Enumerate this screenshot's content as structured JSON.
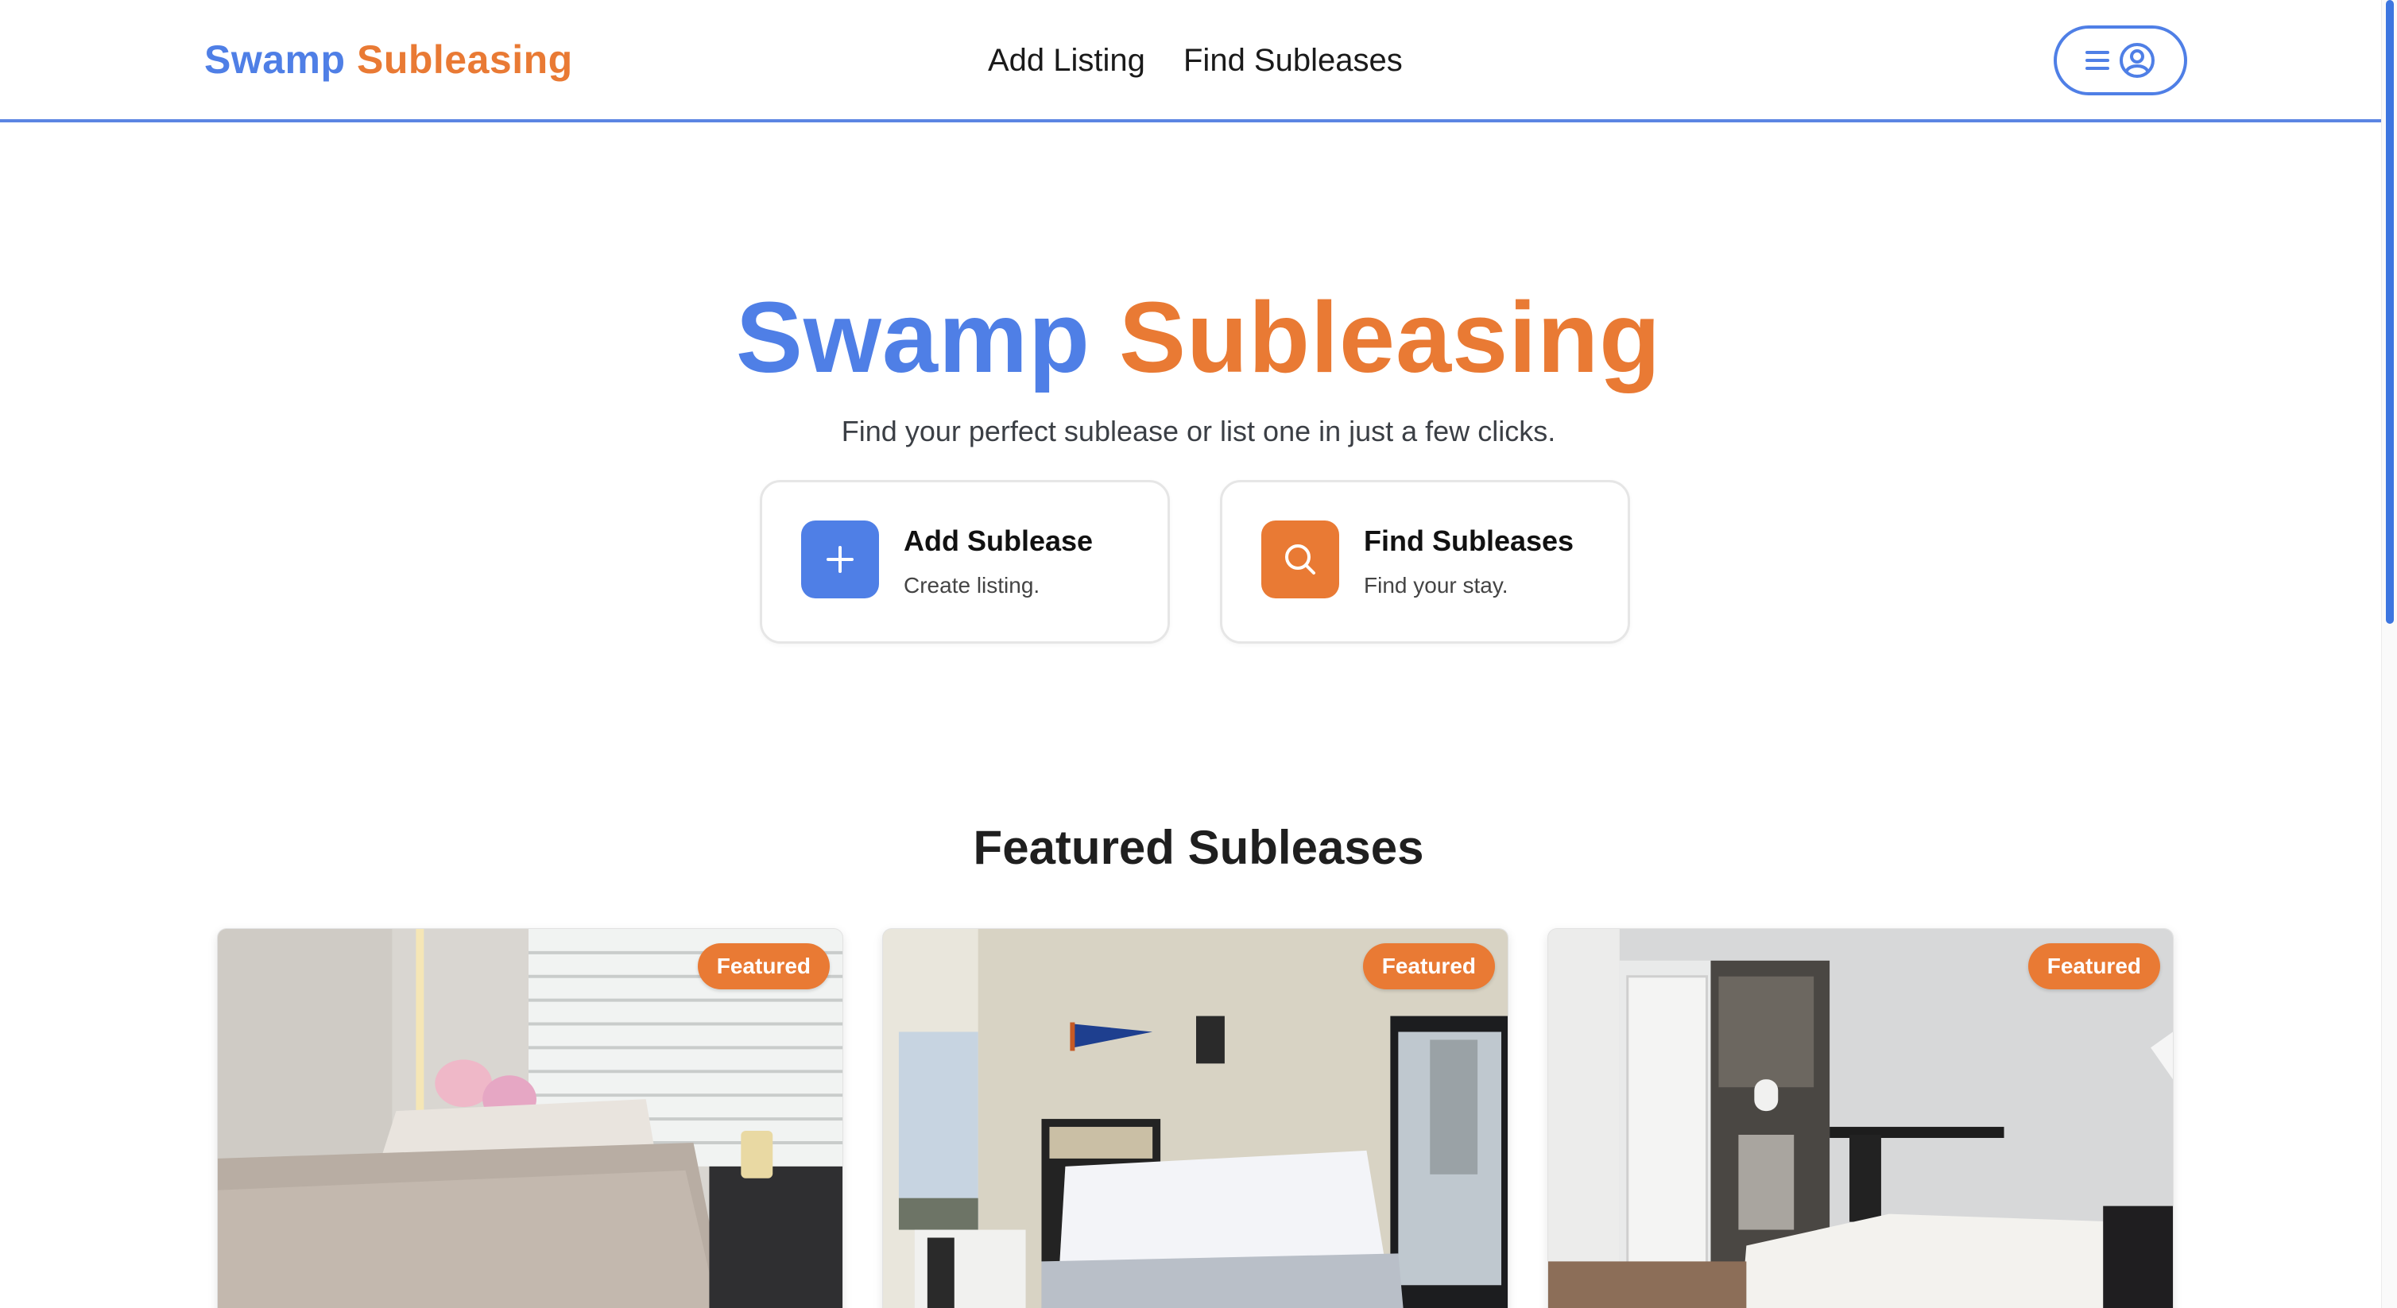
{
  "header": {
    "logo": {
      "part1": "Swamp",
      "part2": "Subleasing"
    },
    "nav": [
      "Add Listing",
      "Find Subleases"
    ]
  },
  "hero": {
    "title": {
      "part1": "Swamp",
      "part2": "Subleasing"
    },
    "subtitle": "Find your perfect sublease or list one in just a few clicks.",
    "actions": [
      {
        "title": "Add Sublease",
        "description": "Create listing.",
        "icon": "plus-icon"
      },
      {
        "title": "Find Subleases",
        "description": "Find your stay.",
        "icon": "search-icon"
      }
    ]
  },
  "featured": {
    "heading": "Featured Subleases",
    "listings": [
      {
        "badge": "Featured",
        "photo": "bedroom-with-window-blinds"
      },
      {
        "badge": "Featured",
        "photo": "bedroom-with-pennant-and-windows"
      },
      {
        "badge": "Featured",
        "photo": "bedroom-with-open-closet"
      }
    ]
  },
  "colors": {
    "brand_blue": "#4f7fe6",
    "brand_orange": "#e97a34"
  },
  "icons": [
    "menu-icon",
    "user-circle-icon",
    "plus-icon",
    "search-icon"
  ]
}
